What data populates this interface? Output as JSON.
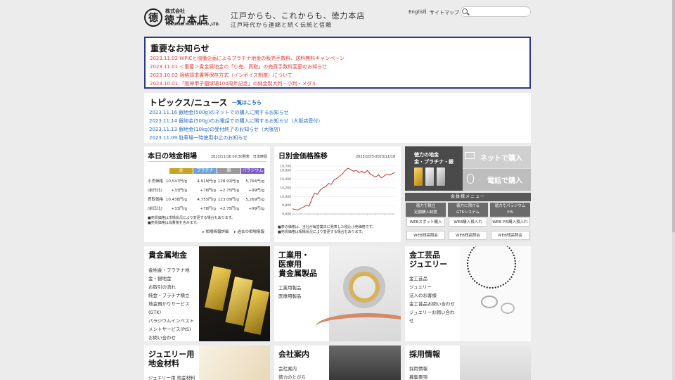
{
  "header": {
    "logo_glyph": "德",
    "company_prefix": "株式会社",
    "company_name": "徳力本店",
    "company_en": "TOKURIKI HONTEN CO.,LTD.",
    "tagline_main": "江戸からも、これからも、徳力本店",
    "tagline_sub": "江戸時代から連綿と続く伝統と信頼",
    "lang_link": "English",
    "lang_separator": "|",
    "sitemap_link": "サイトマップ",
    "search_placeholder": ""
  },
  "notices": {
    "title": "重要なお知らせ",
    "items": [
      "2023.11.02  WPICと協働企画によるプラチナ地金の販売手数料、送料無料キャンペーン",
      "2023.11.01  ＜重要＞貴金属地金の「小売、買取」の売買手数料変更のお知らせ",
      "2023.10.02  適格請求書等保存方式（インボイス制度）について",
      "2023.10.01  「阪神甲子園球場100周年記念」の純金製大判・小判・メダル"
    ]
  },
  "topics": {
    "title": "トピックス/ニュース",
    "list_link": "一覧はこちら",
    "items": [
      "2023.11.16  銀地金(500g)のネットでの購入に関するお知らせ",
      "2023.11.14  銀地金(500g)のお電話での購入に関するお知らせ（大阪店受付）",
      "2023.11.13  銀地金(10kg)の受付終了のお知らせ（大阪店）",
      "2023.11.09  駐車場一時使用中止のお知らせ"
    ]
  },
  "market": {
    "title": "本日の地金相場",
    "timestamp": "2023/11/16 09:30発表　日本時間",
    "metals": [
      "金",
      "プラチナ",
      "銀",
      "パラジウム"
    ],
    "metal_colors": [
      "#c9a227",
      "#6fa3d6",
      "#9a9a9a",
      "#7a5cc9"
    ],
    "rows": [
      {
        "label": "小売価格",
        "values": [
          "10,547円/g",
          "4,919円/g",
          "128.92円/g",
          "5,764円/g"
        ]
      },
      {
        "label": "(前日比)",
        "values": [
          "+33円/g",
          "+78円/g",
          "+2.75円/g",
          "+99円/g"
        ]
      },
      {
        "label": "買取価格",
        "values": [
          "10,438円/g",
          "4,755円/g",
          "123.09円/g",
          "5,269円/g"
        ]
      },
      {
        "label": "(前日比)",
        "values": [
          "+33円/g",
          "+78円/g",
          "+2.75円/g",
          "+99円/g"
        ]
      }
    ],
    "note1": "■売買価格は市場状況により変更する場合もあります。",
    "note2": "■売買価格は消費税を含みます。",
    "link_detail": "▸ 相場情報詳細",
    "link_past": "▸ 過去の相場情報"
  },
  "chart_panel": {
    "title": "日別金価格推移",
    "range": "2023/10/3-2023/11/16",
    "note1": "■表の価格は、当社が毎営業日に発表した税込小売価格です。",
    "note2": "■売買価格は相場状況により変更する場合もあります。"
  },
  "chart_data": {
    "type": "line",
    "title": "日別金価格推移",
    "xlabel": "",
    "ylabel": "",
    "ylim": [
      9600,
      10700
    ],
    "yticks": [
      9600,
      9800,
      10000,
      10200,
      10400,
      10600
    ],
    "ytick_labels": [
      "9,600",
      "9,800",
      "10,000",
      "10,200",
      "10,400",
      "10,600",
      "10,700"
    ],
    "ytick_values_all": [
      9600,
      9800,
      10000,
      10200,
      10400,
      10600,
      10700
    ],
    "line_color": "#b71c1c",
    "series": [
      {
        "values": [
          9720,
          9700,
          9690,
          9730,
          9760,
          9800,
          9780,
          9950,
          10080,
          10050,
          10150,
          10200,
          10230,
          10300,
          10280,
          10380,
          10420,
          10470,
          10520,
          10600,
          10650,
          10620,
          10580,
          10600,
          10550,
          10580,
          10540,
          10600,
          10520,
          10480,
          10450,
          10500,
          10430,
          10470,
          10520,
          10490,
          10530,
          10547
        ]
      }
    ]
  },
  "buy": {
    "heading1": "徳力の地金",
    "heading2": "金・プラチナ・銀",
    "net_label": "ネットで購入",
    "tel_label": "電話で購入",
    "member_menu": "会員様メニュー",
    "columns": [
      {
        "header1": "徳力で積立",
        "header2": "定額購入制度",
        "buttons": [
          "WEBスポット購入",
          "WEB残高照会"
        ]
      },
      {
        "header1": "徳力に預ける",
        "header2": "GTKシステム",
        "buttons": [
          "WEB購入預入れ",
          "WEB残高照会"
        ]
      },
      {
        "header1": "徳力でパラジウム",
        "header2": "PIS",
        "buttons": [
          "WEB PIS購入預入れ",
          "WEB残高照会"
        ]
      }
    ]
  },
  "tiles": {
    "precious": {
      "title": "貴金属地金",
      "links": [
        "金地金・プラチナ地\n金・銀地金",
        "お取引の流れ",
        "純金・プラチナ積立",
        "地金預かりサービス\n(GTK)",
        "パラジウムインベスト\nメントサービス(PIS)",
        "お問い合わせ"
      ]
    },
    "industrial": {
      "title": "工業用・\n医療用\n貴金属製品",
      "links": [
        "工業用製品",
        "医療用製品"
      ]
    },
    "craft": {
      "title": "金工芸品\nジュエリー",
      "links": [
        "金工芸品",
        "ジュエリー",
        "法人のお客様",
        "金工芸品お問い合わせ",
        "ジュエリーお問い合わ\nせ"
      ]
    },
    "jewelry_material": {
      "title": "ジュエリー用\n地金材料",
      "links": [
        "ジュエリー用 地金材料"
      ]
    },
    "company": {
      "title": "会社案内",
      "links": [
        "会社案内",
        "徳力のとびら"
      ]
    },
    "recruit": {
      "title": "採用情報",
      "links": [
        "採用情報",
        "募集要項"
      ]
    }
  }
}
